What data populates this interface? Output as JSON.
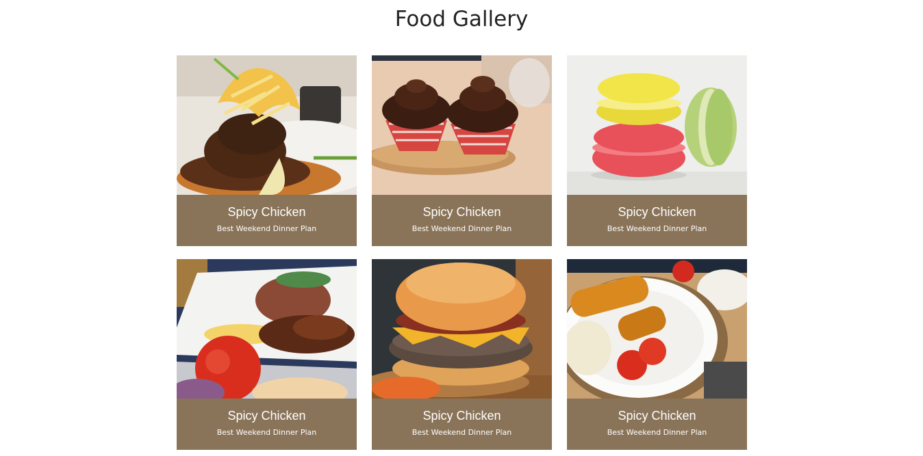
{
  "page": {
    "title": "Food Gallery"
  },
  "theme": {
    "caption_bg": "#8a7459",
    "caption_text": "#ffffff"
  },
  "gallery": {
    "items": [
      {
        "title": "Spicy Chicken",
        "subtitle": "Best Weekend Dinner Plan",
        "photo": "plated-meat-with-slaw"
      },
      {
        "title": "Spicy Chicken",
        "subtitle": "Best Weekend Dinner Plan",
        "photo": "chocolate-cupcakes"
      },
      {
        "title": "Spicy Chicken",
        "subtitle": "Best Weekend Dinner Plan",
        "photo": "macarons"
      },
      {
        "title": "Spicy Chicken",
        "subtitle": "Best Weekend Dinner Plan",
        "photo": "rice-platter-with-tomato"
      },
      {
        "title": "Spicy Chicken",
        "subtitle": "Best Weekend Dinner Plan",
        "photo": "bacon-cheeseburger"
      },
      {
        "title": "Spicy Chicken",
        "subtitle": "Best Weekend Dinner Plan",
        "photo": "spring-rolls-plate"
      }
    ]
  }
}
